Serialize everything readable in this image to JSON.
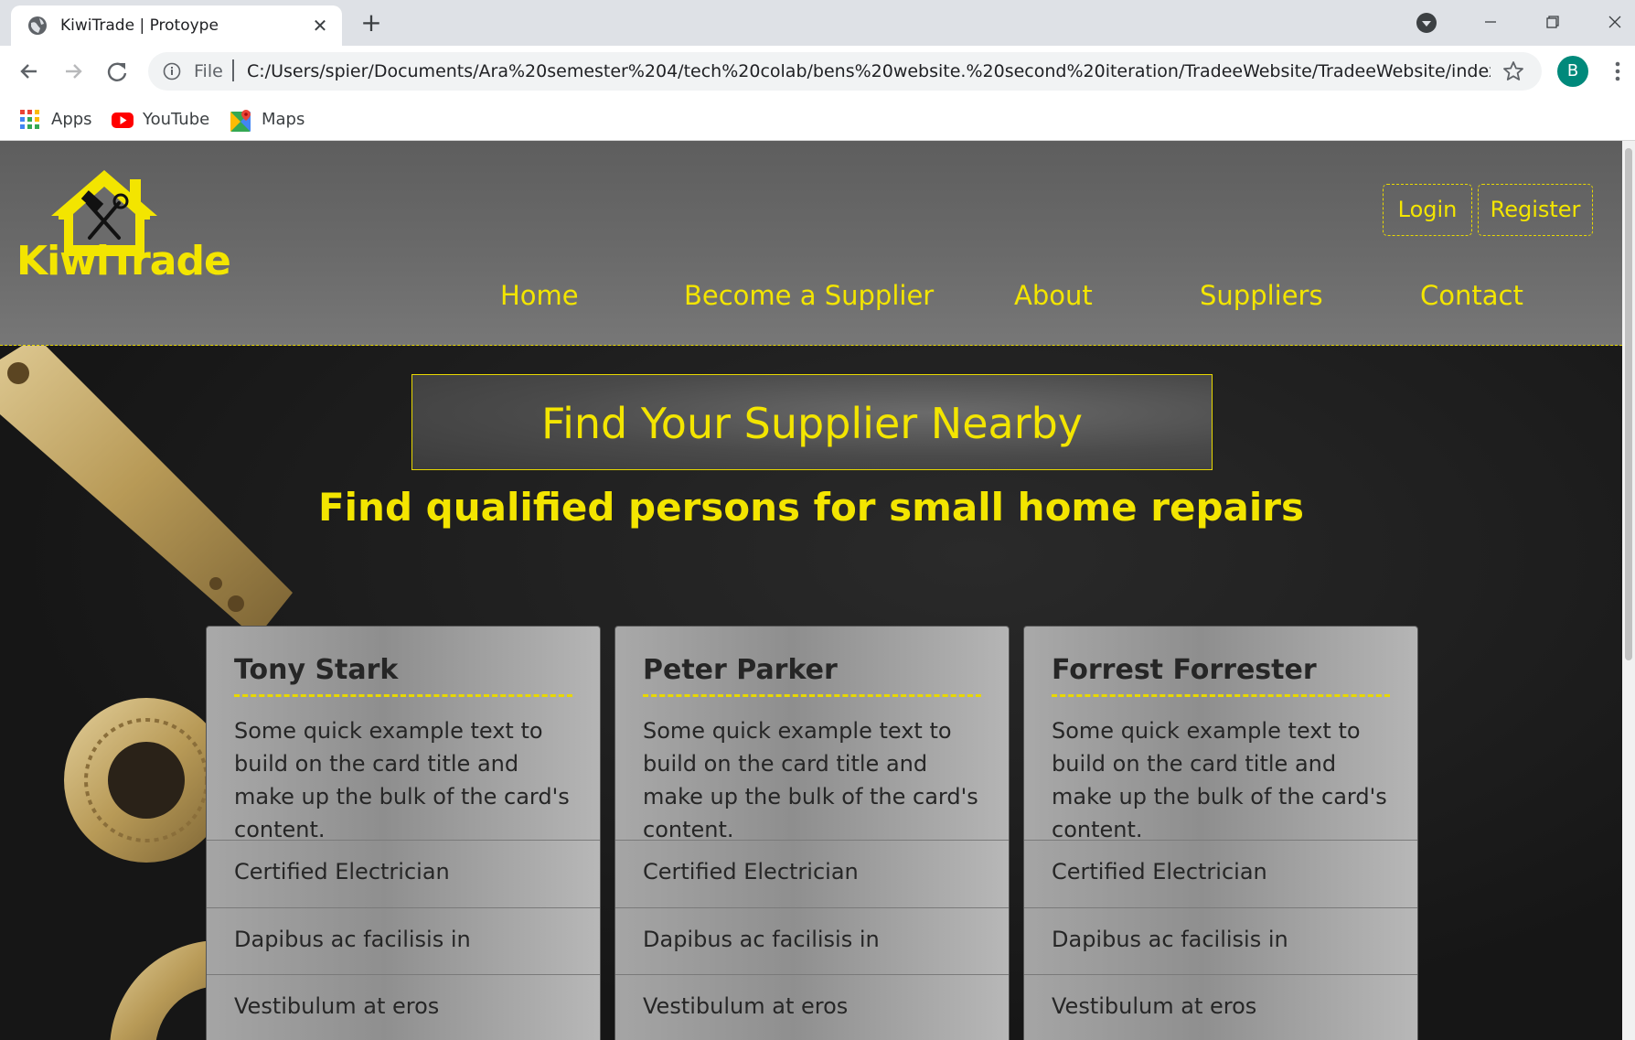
{
  "browser": {
    "tab_title": "KiwiTrade | Protoype",
    "tab_close": "✕",
    "new_tab": "+",
    "omnibox_scheme": "File",
    "url": "C:/Users/spier/Documents/Ara%20semester%204/tech%20colab/bens%20website.%20second%20iteration/TradeeWebsite/TradeeWebsite/index....",
    "avatar_letter": "B",
    "bookmarks": [
      {
        "label": "Apps",
        "icon": "apps-grid-icon"
      },
      {
        "label": "YouTube",
        "icon": "youtube-icon"
      },
      {
        "label": "Maps",
        "icon": "maps-icon"
      }
    ]
  },
  "site": {
    "brand": "KiwiTrade",
    "accent_color": "#f3e500",
    "auth": {
      "login": "Login",
      "register": "Register"
    },
    "nav": [
      "Home",
      "Become a Supplier",
      "About",
      "Suppliers",
      "Contact"
    ],
    "hero": {
      "title": "Find Your Supplier Nearby",
      "subtitle": "Find qualified persons for small home repairs"
    },
    "cards": [
      {
        "name": "Tony Stark",
        "text": "Some quick example text to build on the card title and make up the bulk of the card's content.",
        "items": [
          "Certified Electrician",
          "Dapibus ac facilisis in",
          "Vestibulum at eros"
        ]
      },
      {
        "name": "Peter Parker",
        "text": "Some quick example text to build on the card title and make up the bulk of the card's content.",
        "items": [
          "Certified Electrician",
          "Dapibus ac facilisis in",
          "Vestibulum at eros"
        ]
      },
      {
        "name": "Forrest Forrester",
        "text": "Some quick example text to build on the card title and make up the bulk of the card's content.",
        "items": [
          "Certified Electrician",
          "Dapibus ac facilisis in",
          "Vestibulum at eros"
        ]
      }
    ]
  }
}
